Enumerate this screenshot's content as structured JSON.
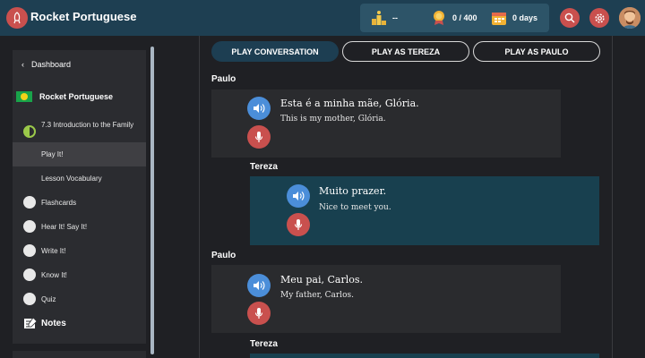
{
  "header": {
    "brand_title": "Rocket Portuguese",
    "stats": {
      "rank_value": "--",
      "points_value": "0 / 400",
      "streak_value": "0 days"
    },
    "colors": {
      "header_bg": "#1e3f52",
      "accent_red": "#c9504e",
      "accent_blue": "#4b8ed9"
    }
  },
  "sidebar": {
    "dashboard_label": "Dashboard",
    "course_title": "Rocket Portuguese",
    "lesson_title": "7.3 Introduction to the Family",
    "items": [
      {
        "label": "Play It!",
        "icon": "none",
        "active": true
      },
      {
        "label": "Lesson Vocabulary",
        "icon": "none",
        "active": false
      },
      {
        "label": "Flashcards",
        "icon": "flashcards-icon",
        "active": false
      },
      {
        "label": "Hear It! Say It!",
        "icon": "headphones-icon",
        "active": false
      },
      {
        "label": "Write It!",
        "icon": "pencil-icon",
        "active": false
      },
      {
        "label": "Know It!",
        "icon": "lightbulb-icon",
        "active": false
      },
      {
        "label": "Quiz",
        "icon": "quiz-icon",
        "active": false
      }
    ],
    "notes_label": "Notes"
  },
  "tabs": [
    {
      "label": "PLAY CONVERSATION",
      "selected": true
    },
    {
      "label": "PLAY AS TEREZA",
      "selected": false
    },
    {
      "label": "PLAY AS PAULO",
      "selected": false
    }
  ],
  "conversation": [
    {
      "speaker": "Paulo",
      "portuguese": "Esta é a minha mãe, Glória.",
      "english": "This is my mother, Glória."
    },
    {
      "speaker": "Tereza",
      "portuguese": "Muito prazer.",
      "english": "Nice to meet you."
    },
    {
      "speaker": "Paulo",
      "portuguese": "Meu pai, Carlos.",
      "english": "My father, Carlos."
    },
    {
      "speaker": "Tereza",
      "portuguese": "",
      "english": ""
    }
  ]
}
